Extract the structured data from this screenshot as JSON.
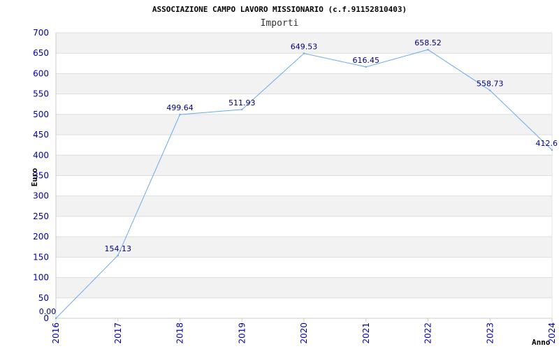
{
  "chart_data": {
    "type": "line",
    "title": "ASSOCIAZIONE CAMPO LAVORO MISSIONARIO (c.f.91152810403)",
    "subtitle": "Importi",
    "xlabel": "Anno",
    "ylabel": "Euro",
    "ylim": [
      0,
      700
    ],
    "yticks": [
      0,
      50,
      100,
      150,
      200,
      250,
      300,
      350,
      400,
      450,
      500,
      550,
      600,
      650,
      700
    ],
    "categories": [
      "2016",
      "2017",
      "2018",
      "2019",
      "2020",
      "2021",
      "2022",
      "2023",
      "2024"
    ],
    "data_labels": [
      "0.00",
      "154.13",
      "499.64",
      "511.93",
      "649.53",
      "616.45",
      "658.52",
      "558.73",
      "412.6"
    ],
    "series": [
      {
        "values": [
          0.0,
          154.13,
          499.64,
          511.93,
          649.53,
          616.45,
          658.52,
          558.73,
          412.6
        ]
      }
    ],
    "grid": true,
    "colors": {
      "line": "#66aaee",
      "band": "#f2f2f2",
      "grid": "#dddddd",
      "tick": "#0000aa",
      "label": "#000080"
    }
  }
}
